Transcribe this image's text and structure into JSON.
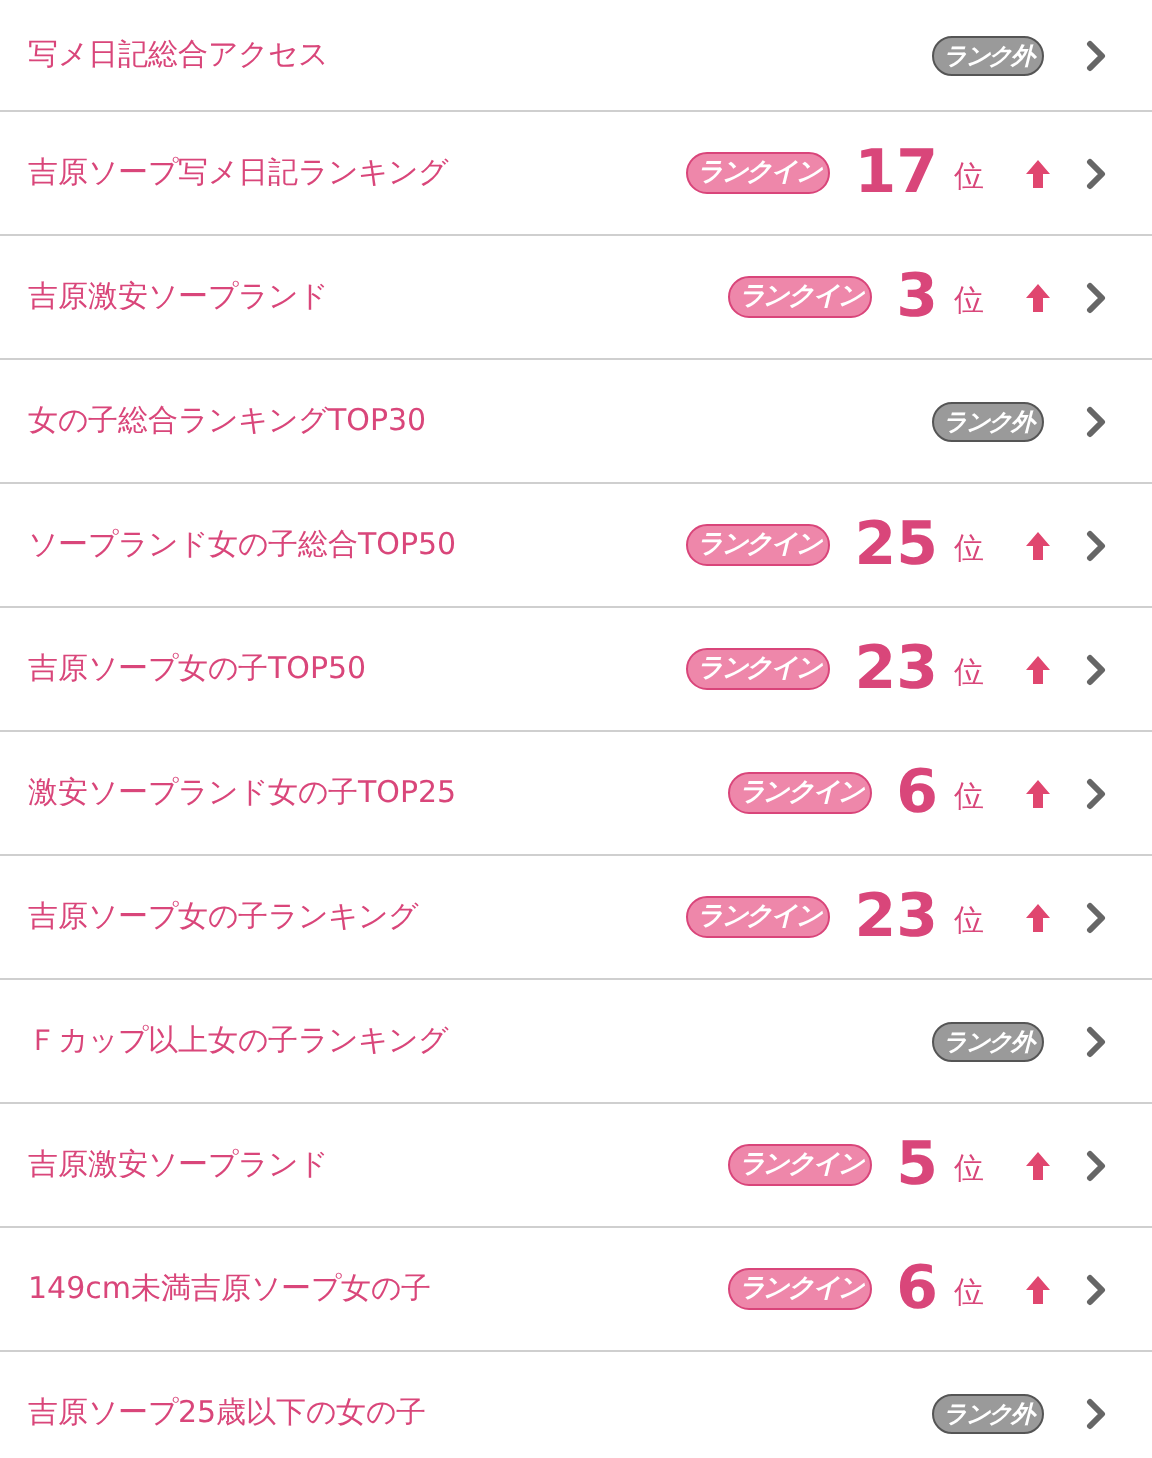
{
  "rows": [
    {
      "title": "写メ日記総合アクセス",
      "kind": "unranked",
      "badge": "ランク外"
    },
    {
      "title": "吉原ソープ写メ日記ランキング",
      "kind": "ranked",
      "badge": "ランクイン",
      "rank": "17",
      "unit": "位"
    },
    {
      "title": "吉原激安ソープランド",
      "kind": "ranked",
      "badge": "ランクイン",
      "rank": "3",
      "unit": "位"
    },
    {
      "title": "女の子総合ランキングTOP30",
      "kind": "unranked",
      "badge": "ランク外"
    },
    {
      "title": "ソープランド女の子総合TOP50",
      "kind": "ranked",
      "badge": "ランクイン",
      "rank": "25",
      "unit": "位"
    },
    {
      "title": "吉原ソープ女の子TOP50",
      "kind": "ranked",
      "badge": "ランクイン",
      "rank": "23",
      "unit": "位"
    },
    {
      "title": "激安ソープランド女の子TOP25",
      "kind": "ranked",
      "badge": "ランクイン",
      "rank": "6",
      "unit": "位"
    },
    {
      "title": "吉原ソープ女の子ランキング",
      "kind": "ranked",
      "badge": "ランクイン",
      "rank": "23",
      "unit": "位"
    },
    {
      "title": "Ｆカップ以上女の子ランキング",
      "kind": "unranked",
      "badge": "ランク外"
    },
    {
      "title": "吉原激安ソープランド",
      "kind": "ranked",
      "badge": "ランクイン",
      "rank": "5",
      "unit": "位"
    },
    {
      "title": "149cm未満吉原ソープ女の子",
      "kind": "ranked",
      "badge": "ランクイン",
      "rank": "6",
      "unit": "位"
    },
    {
      "title": "吉原ソープ25歳以下の女の子",
      "kind": "unranked",
      "badge": "ランク外"
    }
  ]
}
